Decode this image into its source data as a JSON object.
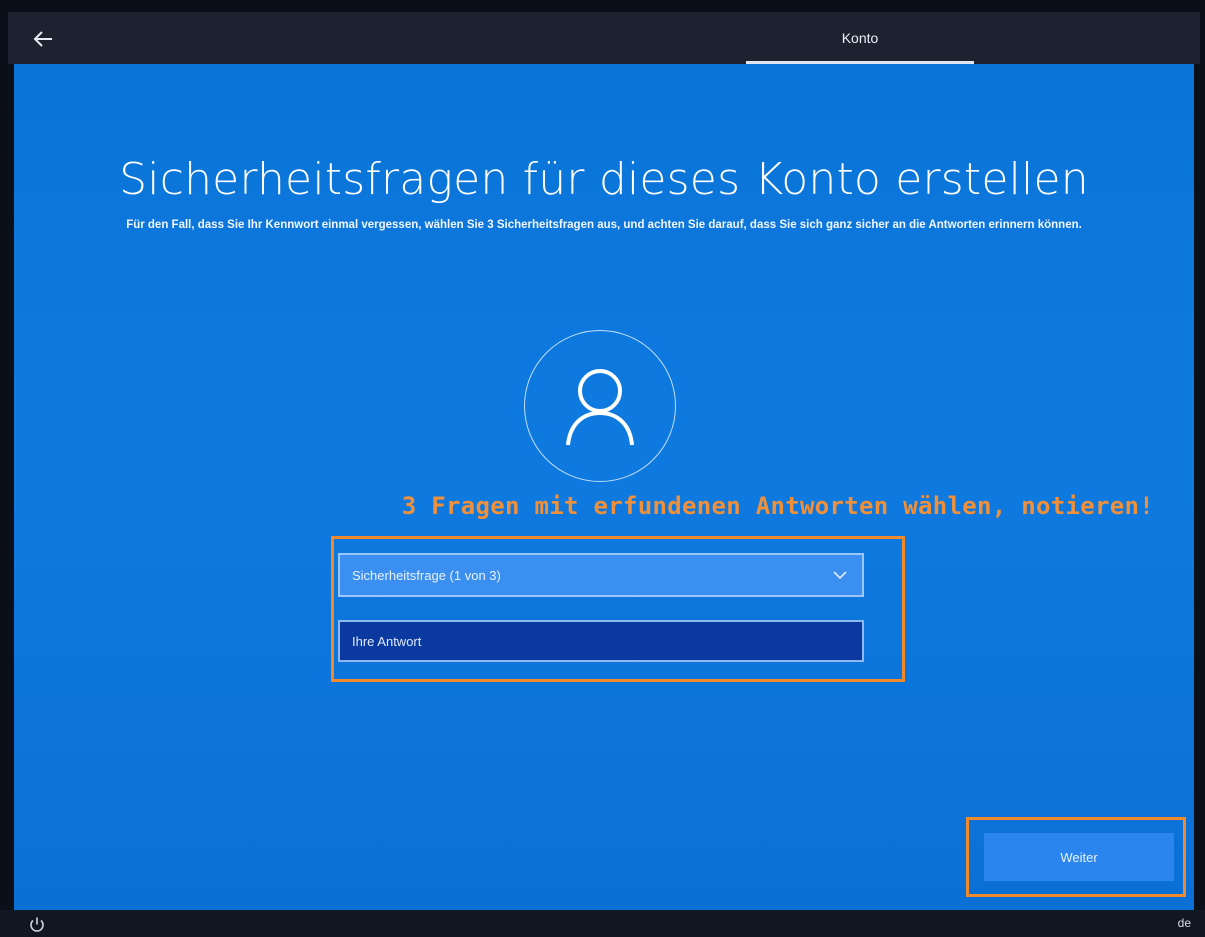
{
  "header": {
    "back_icon": "arrow-left-icon",
    "tab_label": "Konto"
  },
  "main": {
    "title": "Sicherheitsfragen für dieses Konto erstellen",
    "subtitle": "Für den Fall, dass Sie Ihr Kennwort einmal vergessen, wählen Sie 3 Sicherheitsfragen aus, und achten Sie darauf, dass Sie sich ganz sicher an die Antworten erinnern können.",
    "avatar_icon": "user-icon",
    "annotation": "3 Fragen mit erfundenen Antworten wählen, notieren!",
    "question_select": {
      "selected": "Sicherheitsfrage (1 von 3)",
      "icon": "chevron-down-icon"
    },
    "answer_input": {
      "value": "",
      "placeholder": "Ihre Antwort"
    },
    "next_button_label": "Weiter"
  },
  "footer": {
    "power_icon": "power-icon",
    "language": "de"
  },
  "colors": {
    "background": "#0e7ae0",
    "annotation_orange": "#f08a2c",
    "answer_field": "#0a3aa0",
    "button": "#2a86ee"
  }
}
